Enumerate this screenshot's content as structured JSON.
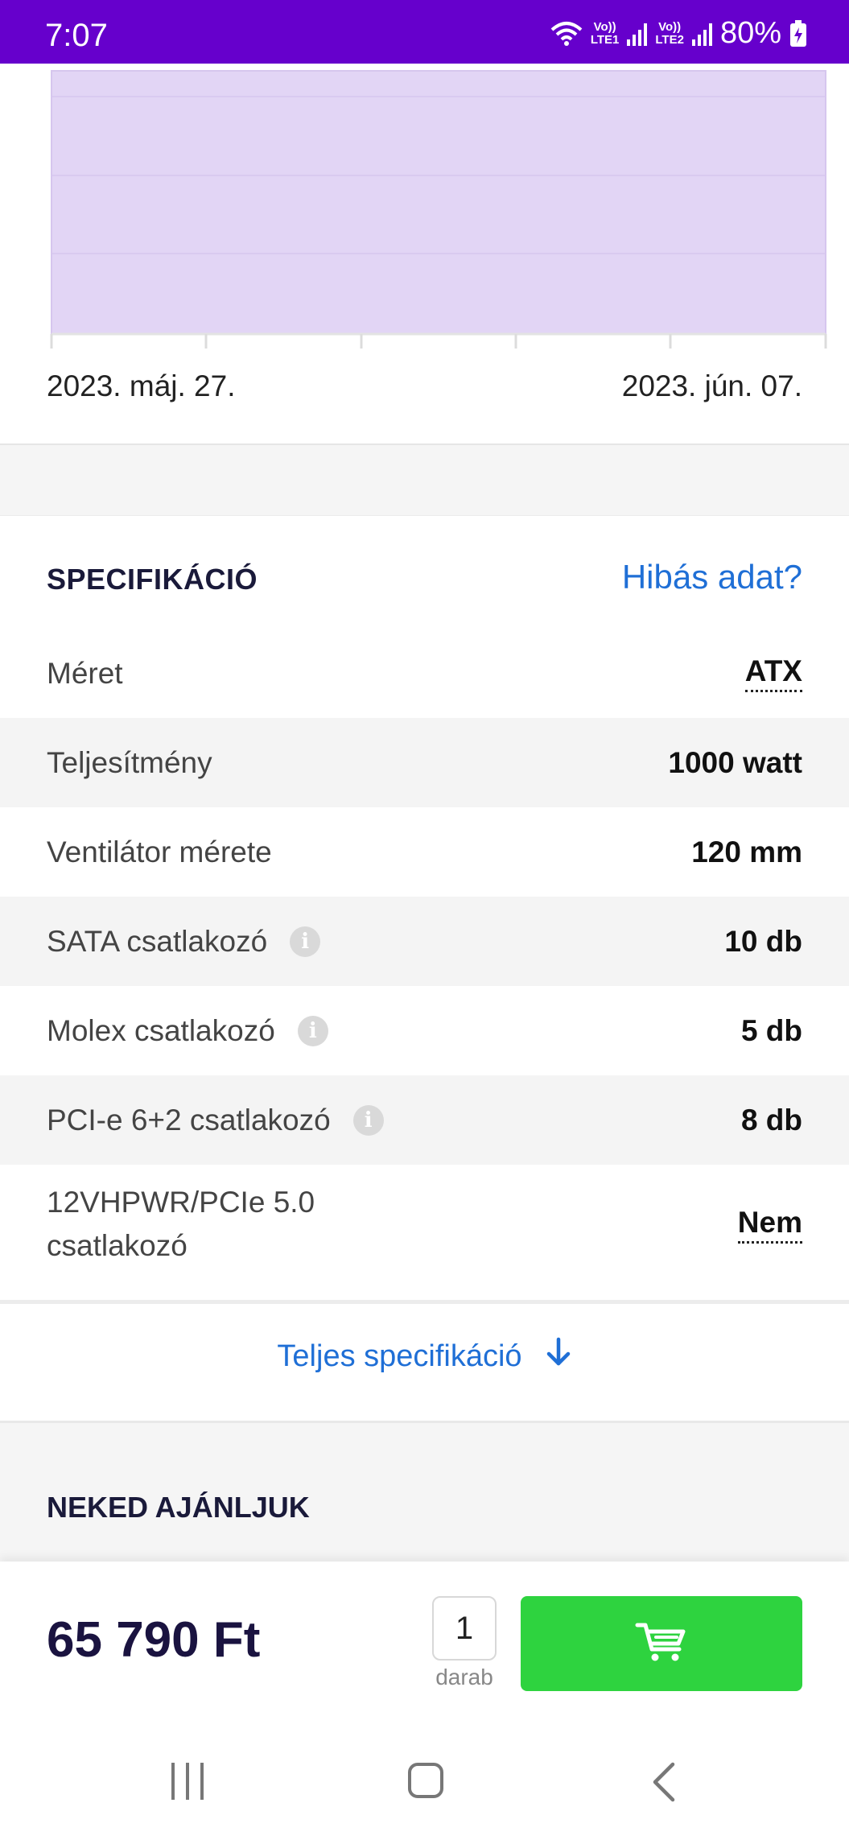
{
  "status_bar": {
    "time": "7:07",
    "battery": "80%",
    "sim1_top": "Vo))",
    "sim1_bottom": "LTE1",
    "sim2_top": "Vo))",
    "sim2_bottom": "LTE2",
    "icons": [
      "wifi-icon",
      "signal-icon",
      "battery-charging-icon"
    ]
  },
  "chart": {
    "date_start": "2023. máj. 27.",
    "date_end": "2023. jún. 07.",
    "fill_color": "#e2d5f5",
    "grid_color": "#d6c6ee"
  },
  "specs": {
    "title": "SPECIFIKÁCIÓ",
    "report_link": "Hibás adat?",
    "rows": [
      {
        "label": "Méret",
        "value": "ATX",
        "info": false
      },
      {
        "label": "Teljesítmény",
        "value": "1000 watt",
        "info": false
      },
      {
        "label": "Ventilátor mérete",
        "value": "120 mm",
        "info": false
      },
      {
        "label": "SATA csatlakozó",
        "value": "10 db",
        "info": true
      },
      {
        "label": "Molex csatlakozó",
        "value": "5 db",
        "info": true
      },
      {
        "label": "PCI-e 6+2 csatlakozó",
        "value": "8 db",
        "info": true
      },
      {
        "label_line1": "12VHPWR/PCIe 5.0",
        "label_line2": "csatlakozó",
        "value": "Nem",
        "info": false
      }
    ],
    "full_spec_link": "Teljes specifikáció",
    "info_glyph": "i"
  },
  "recommend": {
    "title": "NEKED AJÁNLJUK"
  },
  "bottom": {
    "price": "65 790 Ft",
    "quantity": "1",
    "quantity_label": "darab",
    "cart_icon": "cart-icon",
    "button_color": "#2ed33f"
  },
  "colors": {
    "accent": "#6600cc",
    "link": "#1f6fd6",
    "heading": "#1a1a3a"
  }
}
